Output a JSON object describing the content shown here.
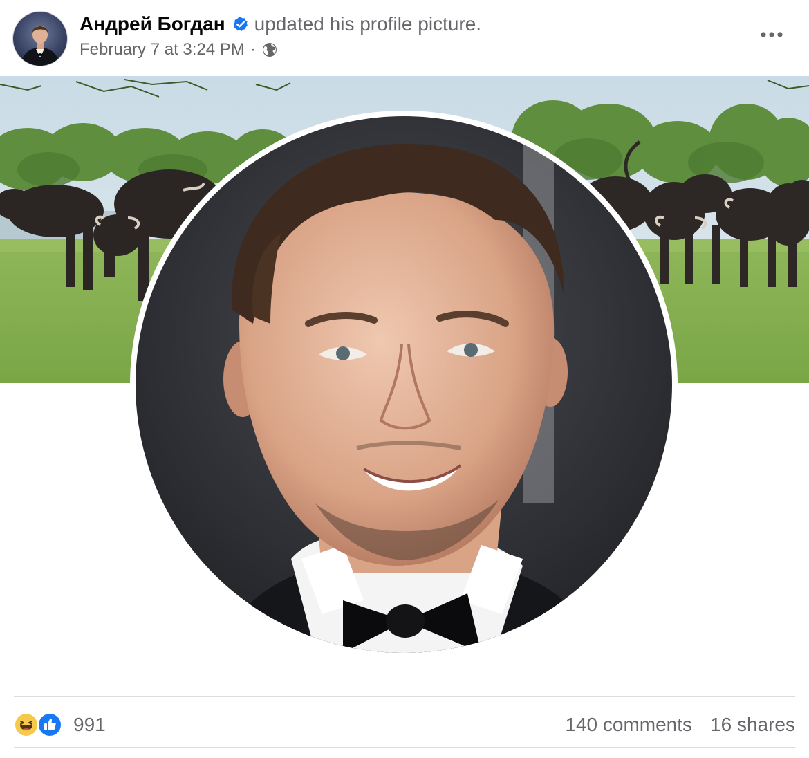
{
  "post": {
    "author": "Андрей Богдан",
    "verified": true,
    "action": "updated his profile picture.",
    "timestamp": "February 7 at 3:24 PM",
    "separator": "·",
    "audience_icon": "globe-icon",
    "menu_icon": "more-options-icon"
  },
  "media": {
    "cover_description_icon": "cover-photo",
    "profile_description_icon": "profile-photo"
  },
  "stats": {
    "reactions": [
      "haha",
      "like"
    ],
    "reaction_count": "991",
    "comments": "140 comments",
    "shares": "16 shares"
  },
  "colors": {
    "verified_blue": "#1877f2",
    "secondary_text": "#65676b",
    "primary_text": "#050505",
    "divider": "#dadde1"
  }
}
